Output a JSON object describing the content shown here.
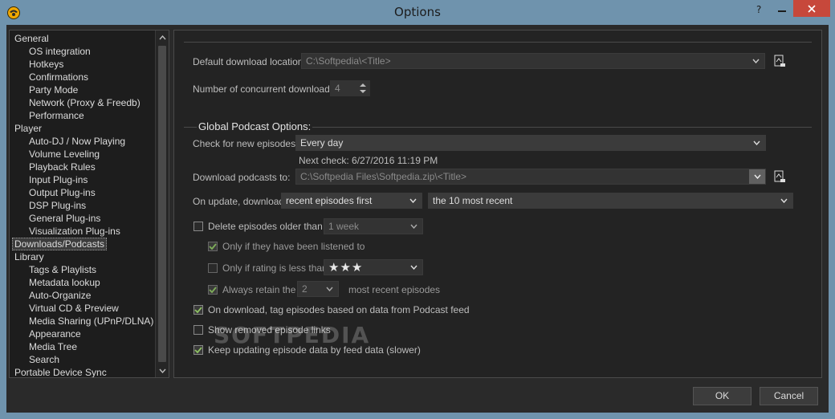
{
  "window": {
    "title": "Options"
  },
  "tree": {
    "items": [
      {
        "label": "General",
        "level": 0
      },
      {
        "label": "OS integration",
        "level": 1
      },
      {
        "label": "Hotkeys",
        "level": 1
      },
      {
        "label": "Confirmations",
        "level": 1
      },
      {
        "label": "Party Mode",
        "level": 1
      },
      {
        "label": "Network (Proxy & Freedb)",
        "level": 1
      },
      {
        "label": "Performance",
        "level": 1
      },
      {
        "label": "Player",
        "level": 0
      },
      {
        "label": "Auto-DJ / Now Playing",
        "level": 1
      },
      {
        "label": "Volume Leveling",
        "level": 1
      },
      {
        "label": "Playback Rules",
        "level": 1
      },
      {
        "label": "Input Plug-ins",
        "level": 1
      },
      {
        "label": "Output Plug-ins",
        "level": 1
      },
      {
        "label": "DSP Plug-ins",
        "level": 1
      },
      {
        "label": "General Plug-ins",
        "level": 1
      },
      {
        "label": "Visualization Plug-ins",
        "level": 1
      },
      {
        "label": "Downloads/Podcasts",
        "level": 0,
        "selected": true
      },
      {
        "label": "Library",
        "level": 0
      },
      {
        "label": "Tags & Playlists",
        "level": 1
      },
      {
        "label": "Metadata lookup",
        "level": 1
      },
      {
        "label": "Auto-Organize",
        "level": 1
      },
      {
        "label": "Virtual CD & Preview",
        "level": 1
      },
      {
        "label": "Media Sharing (UPnP/DLNA)",
        "level": 1
      },
      {
        "label": "Appearance",
        "level": 1
      },
      {
        "label": "Media Tree",
        "level": 1
      },
      {
        "label": "Search",
        "level": 1
      },
      {
        "label": "Portable Device Sync",
        "level": 0
      }
    ]
  },
  "downloads": {
    "location_label": "Default download location:",
    "location_value": "C:\\Softpedia\\<Title>",
    "concurrent_label": "Number of concurrent downloads:",
    "concurrent_value": "4"
  },
  "podcast": {
    "group_title": "Global Podcast Options:",
    "check_label": "Check for new episodes:",
    "check_value": "Every day",
    "next_check": "Next check: 6/27/2016 11:19 PM",
    "download_to_label": "Download podcasts to:",
    "download_to_value": "C:\\Softpedia Files\\Softpedia.zip\\<Title>",
    "on_update_label": "On update, download",
    "on_update_value": "recent episodes first",
    "most_recent_value": "the 10 most recent",
    "delete_label": "Delete episodes older than",
    "delete_checked": false,
    "delete_value": "1 week",
    "listened_label": "Only if they have been listened to",
    "listened_checked": true,
    "rating_label": "Only if rating is less than",
    "rating_checked": false,
    "rating_stars": "★★★",
    "retain_label": "Always retain the",
    "retain_checked": true,
    "retain_value": "2",
    "retain_suffix": "most recent episodes",
    "tag_label": "On download, tag episodes based on data from Podcast feed",
    "tag_checked": true,
    "removed_label": "Show removed episode links",
    "removed_checked": false,
    "keep_label": "Keep updating episode data by feed data (slower)",
    "keep_checked": true
  },
  "watermark": "SOFTPEDIA",
  "buttons": {
    "ok": "OK",
    "cancel": "Cancel"
  },
  "colors": {
    "titlebar": "#6f93ad",
    "close": "#c7483b",
    "panel": "#232323"
  }
}
